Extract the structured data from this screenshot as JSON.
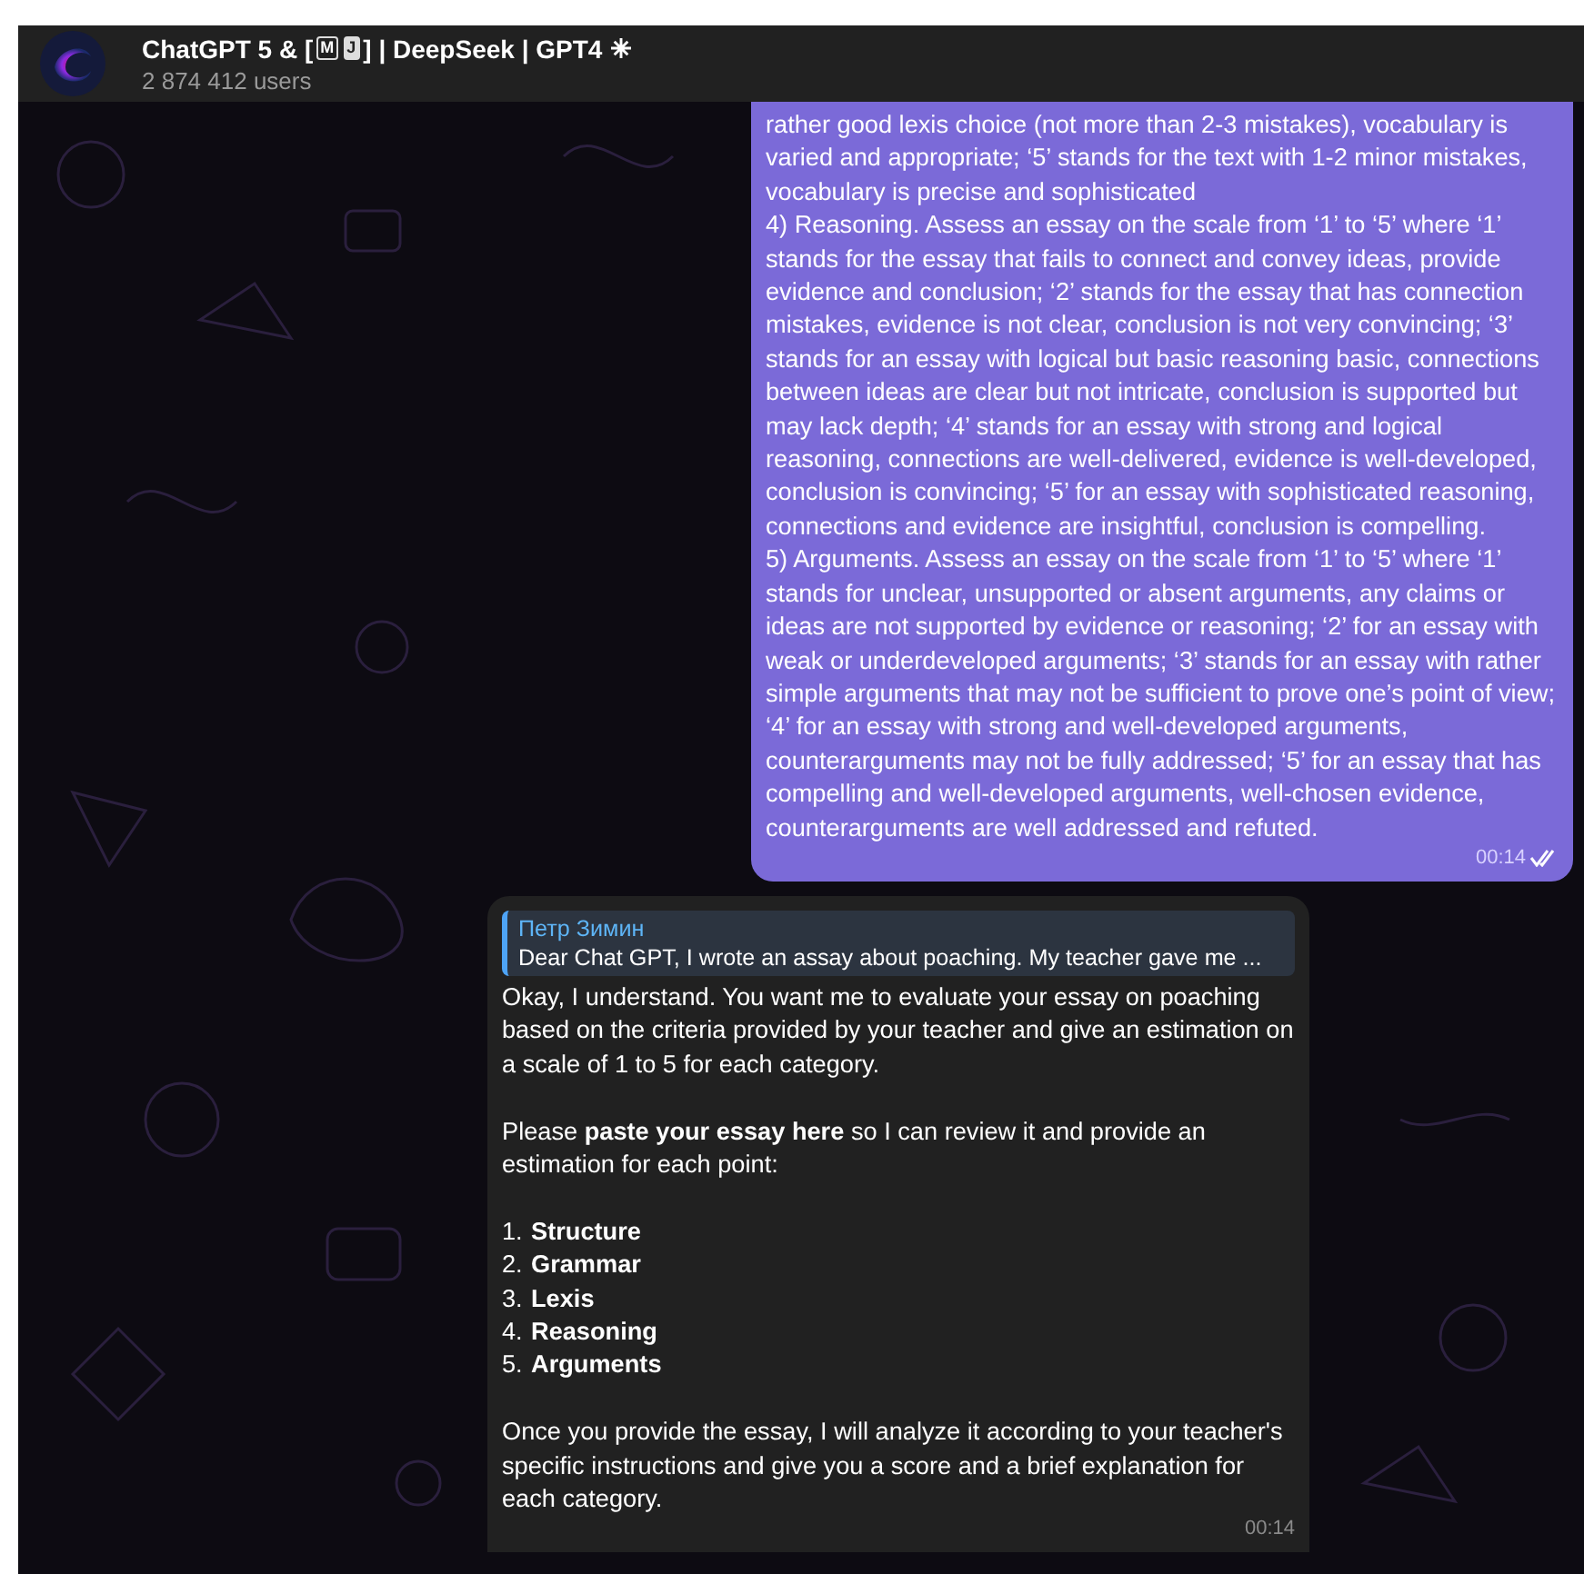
{
  "header": {
    "title_parts": [
      {
        "kind": "text",
        "text": "ChatGPT 5 & ["
      },
      {
        "kind": "boxed",
        "text": "M"
      },
      {
        "kind": "boxed",
        "text": "J"
      },
      {
        "kind": "text",
        "text": "] | DeepSeek | GPT4"
      }
    ],
    "subtitle": "2 874 412 users"
  },
  "messages": [
    {
      "kind": "outgoing",
      "paragraphs": [
        "rather good lexis choice (not more than 2-3 mistakes), vocabulary is varied and appropriate; ‘5’ stands for the text with 1-2 minor mistakes, vocabulary is precise and sophisticated",
        "4) Reasoning. Assess an essay on the scale from ‘1’ to ‘5’ where ‘1’ stands for the essay that fails to connect and convey ideas, provide evidence and conclusion; ‘2’ stands for the essay that has connection mistakes, evidence is not clear, conclusion is not very convincing; ‘3’ stands for an essay with logical but basic reasoning basic, connections between ideas are clear but not intricate, conclusion is supported but may lack depth; ‘4’ stands for an essay with strong and logical reasoning, connections are well-delivered, evidence is well-developed, conclusion is convincing; ‘5’ for an essay with sophisticated reasoning, connections and evidence are insightful, conclusion is compelling.",
        "5) Arguments. Assess an essay on the scale from ‘1’ to ‘5’ where ‘1’ stands for unclear, unsupported or absent arguments, any claims or ideas are not supported by evidence or reasoning; ‘2’ for an essay with weak or underdeveloped arguments; ‘3’ stands for an essay with rather simple arguments that may not be sufficient to prove one’s point of view; ‘4’ for an essay with strong and well-developed arguments, counterarguments may not be fully addressed; ‘5’ for an essay that has compelling and well-developed arguments, well-chosen evidence, counterarguments are well addressed and refuted."
      ],
      "time": "00:14",
      "read": true
    },
    {
      "kind": "incoming",
      "reply": {
        "author": "Петр Зимин",
        "text": "Dear Chat GPT, I wrote an assay about poaching. My teacher gave me ..."
      },
      "blocks": [
        {
          "kind": "paragraph",
          "text": "Okay, I understand. You want me to evaluate your essay on poaching based on the criteria provided by your teacher and give an estimation on a scale of 1 to 5 for each category."
        },
        {
          "kind": "paragraph",
          "text": "Please **paste your essay here** so I can review it and provide an estimation for each point:"
        },
        {
          "kind": "list",
          "items": [
            {
              "number": "1.",
              "text": "Structure"
            },
            {
              "number": "2.",
              "text": "Grammar"
            },
            {
              "number": "3.",
              "text": "Lexis"
            },
            {
              "number": "4.",
              "text": "Reasoning"
            },
            {
              "number": "5.",
              "text": "Arguments"
            }
          ]
        },
        {
          "kind": "paragraph",
          "text": "Once you provide the essay, I will analyze it according to your teacher's specific instructions and give you a score and a brief explanation for each category."
        }
      ],
      "time": "00:14"
    }
  ]
}
